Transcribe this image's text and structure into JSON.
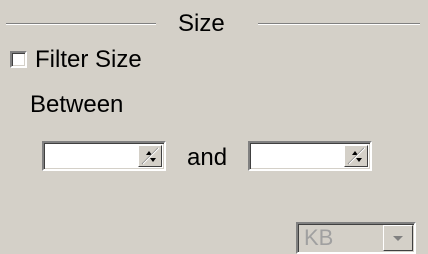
{
  "group": {
    "title": "Size"
  },
  "filter": {
    "checkbox_label": "Filter Size",
    "checked": false
  },
  "range": {
    "between_label": "Between",
    "and_label": "and",
    "from_value": "",
    "to_value": ""
  },
  "unit": {
    "selected": "KB",
    "disabled": true
  },
  "icons": {
    "spin_up": "spin-up-icon",
    "spin_down": "spin-down-icon",
    "dropdown": "chevron-down-icon"
  }
}
